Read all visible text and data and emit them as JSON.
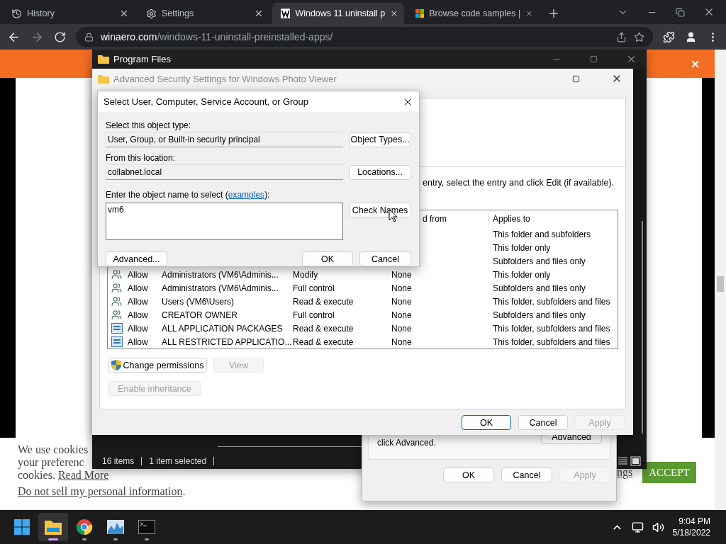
{
  "browser": {
    "tabs": [
      {
        "label": "History",
        "kind": "history",
        "selected": false
      },
      {
        "label": "Settings",
        "kind": "settings",
        "selected": false
      },
      {
        "label": "Windows 11 uninstall p",
        "kind": "article",
        "selected": true
      },
      {
        "label": "Browse code samples |",
        "kind": "samples",
        "selected": false
      }
    ],
    "url": {
      "domain": "winaero.com",
      "path": "/windows-11-uninstall-preinstalled-apps/"
    }
  },
  "cookie_banner": {
    "lines": [
      "We use cookies",
      "your preferenc"
    ],
    "cookies_text": "cookies.",
    "read_more": "Read More",
    "opt_out_link": "Do not sell my personal information",
    "opt_out_end": ".",
    "settings_fragment": "ngs",
    "accept": "ACCEPT"
  },
  "explorer": {
    "title": "Program Files",
    "status": [
      "16 items",
      "1 item selected"
    ]
  },
  "properties_dialog": {
    "text": "click Advanced.",
    "advanced": "Advanced",
    "buttons": [
      {
        "label": "OK",
        "disabled": false
      },
      {
        "label": "Cancel",
        "disabled": false
      },
      {
        "label": "Apply",
        "disabled": true
      }
    ]
  },
  "security_window": {
    "title": "Advanced Security Settings for Windows Photo Viewer",
    "instructions": "entry, select the entry and click Edit (if available).",
    "columns": [
      "d from",
      "Applies to"
    ],
    "rows": [
      {
        "applies_to": "This folder and subfolders"
      },
      {
        "applies_to": "This folder only"
      },
      {
        "applies_to": "Subfolders and files only"
      },
      {
        "kind": "user",
        "type": "Allow",
        "principal": "Administrators (VM6\\Adminis...",
        "access": "Modify",
        "inherited": "None",
        "applies_to": "This folder only"
      },
      {
        "kind": "user",
        "type": "Allow",
        "principal": "Administrators (VM6\\Adminis...",
        "access": "Full control",
        "inherited": "None",
        "applies_to": "Subfolders and files only"
      },
      {
        "kind": "user",
        "type": "Allow",
        "principal": "Users (VM6\\Users)",
        "access": "Read & execute",
        "inherited": "None",
        "applies_to": "This folder, subfolders and files"
      },
      {
        "kind": "user",
        "type": "Allow",
        "principal": "CREATOR OWNER",
        "access": "Full control",
        "inherited": "None",
        "applies_to": "Subfolders and files only"
      },
      {
        "kind": "package",
        "type": "Allow",
        "principal": "ALL APPLICATION PACKAGES",
        "access": "Read & execute",
        "inherited": "None",
        "applies_to": "This folder, subfolders and files"
      },
      {
        "kind": "package",
        "type": "Allow",
        "principal": "ALL RESTRICTED APPLICATIO...",
        "access": "Read & execute",
        "inherited": "None",
        "applies_to": "This folder, subfolders and files"
      }
    ],
    "change_permissions": {
      "label": "Change permissions",
      "disabled": false
    },
    "view": {
      "label": "View",
      "disabled": true
    },
    "enable_inheritance": {
      "label": "Enable inheritance",
      "disabled": true
    },
    "buttons": [
      {
        "label": "OK",
        "disabled": false,
        "default": true
      },
      {
        "label": "Cancel",
        "disabled": false,
        "default": false
      },
      {
        "label": "Apply",
        "disabled": true,
        "default": false
      }
    ]
  },
  "select_dialog": {
    "title": "Select User, Computer, Service Account, or Group",
    "object_type_label": "Select this object type:",
    "object_type": "User, Group, or Built-in security principal",
    "object_types_button": "Object Types...",
    "location_label": "From this location:",
    "location": "collabnet.local",
    "locations_button": "Locations...",
    "name_label": "Enter the object name to select (",
    "examples_link": "examples",
    "name_label_end": "):",
    "name_value": "vm6",
    "check_names": "Check Names",
    "advanced": "Advanced...",
    "ok": "OK",
    "cancel": "Cancel"
  },
  "taskbar": {
    "apps": [
      {
        "kind": "start",
        "active": false,
        "running": false
      },
      {
        "kind": "explorer",
        "active": true,
        "running": true
      },
      {
        "kind": "chrome",
        "active": false,
        "running": true
      },
      {
        "kind": "monitor",
        "active": false,
        "running": true
      },
      {
        "kind": "terminal",
        "active": false,
        "running": true
      }
    ],
    "time": "9:04 PM",
    "date": "5/18/2022"
  }
}
